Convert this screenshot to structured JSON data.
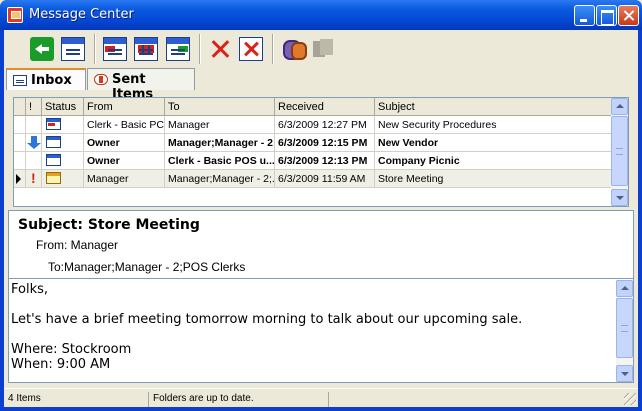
{
  "window": {
    "title": "Message Center"
  },
  "toolbar": {
    "back": "back-icon",
    "new_message": "new-message-icon",
    "reply": "reply-icon",
    "reply_all": "reply-all-icon",
    "forward": "forward-icon",
    "delete": "delete-icon",
    "undelete": "undelete-icon",
    "address_book": "address-book-icon",
    "disabled_tool": "folder-icon"
  },
  "tabs": [
    {
      "label": "Inbox",
      "active": true
    },
    {
      "label": "Sent Items",
      "active": false
    }
  ],
  "grid": {
    "columns": [
      "!",
      "Status",
      "From",
      "To",
      "Received",
      "Subject"
    ],
    "rows": [
      {
        "flag": "",
        "status": "unread-reply",
        "from": "Clerk - Basic PC...",
        "to": "Manager",
        "received": "6/3/2009 12:27 PM",
        "subject": "New Security Procedures",
        "bold": false,
        "selected": false,
        "marker": ""
      },
      {
        "flag": "down",
        "status": "unread",
        "from": "Owner",
        "to": "Manager;Manager - 2",
        "received": "6/3/2009 12:15 PM",
        "subject": "New Vendor",
        "bold": true,
        "selected": false,
        "marker": ""
      },
      {
        "flag": "",
        "status": "unread",
        "from": "Owner",
        "to": "Clerk - Basic POS u...",
        "received": "6/3/2009 12:13 PM",
        "subject": "Company Picnic",
        "bold": true,
        "selected": false,
        "marker": ""
      },
      {
        "flag": "high",
        "status": "read",
        "from": "Manager",
        "to": "Manager;Manager - 2;...",
        "received": "6/3/2009 11:59 AM",
        "subject": "Store Meeting",
        "bold": false,
        "selected": true,
        "marker": "current"
      }
    ]
  },
  "preview": {
    "subject_line": "Subject: Store Meeting",
    "from_line": "From: Manager",
    "to_line": "To:Manager;Manager - 2;POS Clerks",
    "body": "Folks,\n\nLet's have a brief meeting tomorrow morning to talk about our upcoming sale.\n\nWhere: Stockroom\nWhen: 9:00 AM"
  },
  "status": {
    "count": "4 Items",
    "message": "Folders are up to date."
  },
  "colors": {
    "titlebar": "#0a5be0",
    "tab_active_accent": "#e68b2c",
    "high_priority": "#d8231b",
    "down_arrow": "#2b78d8"
  }
}
